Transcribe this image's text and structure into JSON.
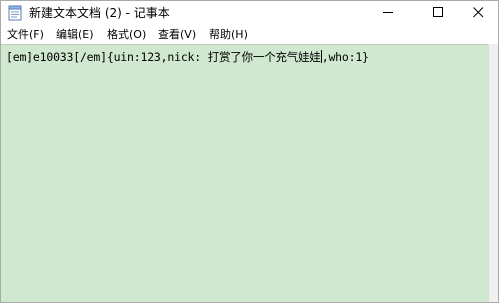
{
  "window": {
    "title": "新建文本文档 (2) - 记事本",
    "icons": {
      "app": "notepad-icon",
      "minimize": "minimize-icon",
      "maximize": "maximize-icon",
      "close": "close-icon"
    }
  },
  "menu": {
    "items": [
      {
        "label": "文件(F)"
      },
      {
        "label": "编辑(E)"
      },
      {
        "label": "格式(O)"
      },
      {
        "label": "查看(V)"
      },
      {
        "label": "帮助(H)"
      }
    ]
  },
  "editor": {
    "content_before_caret": "[em]e10033[/em]{uin:123,nick: 打赏了你一个充气娃娃",
    "content_after_caret": ",who:1}",
    "background_color": "#cfe8cf"
  }
}
